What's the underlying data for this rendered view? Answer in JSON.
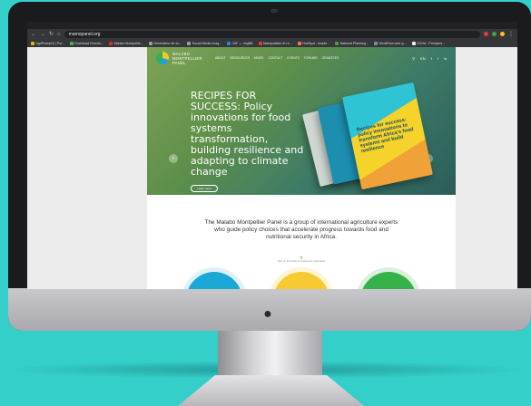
{
  "browser": {
    "url": "mamopanel.org",
    "bookmarks": [
      {
        "label": "AgriPolicyKit | Pol...",
        "color": "#f2b300"
      },
      {
        "label": "Download Exercis...",
        "color": "#4caf50"
      },
      {
        "label": "Malabo Montpellie...",
        "color": "#d32f2f"
      },
      {
        "label": "Générateur de su...",
        "color": "#9e9e9e"
      },
      {
        "label": "Social Media Imag...",
        "color": "#9e9e9e"
      },
      {
        "label": "JVF — ImgBB",
        "color": "#1e88e5"
      },
      {
        "label": "Manipulation et ré...",
        "color": "#e53935"
      },
      {
        "label": "HubSpot - Acade...",
        "color": "#ff7043"
      },
      {
        "label": "National Planning...",
        "color": "#43a047"
      },
      {
        "label": "WordFlow user g...",
        "color": "#78909c"
      },
      {
        "label": "OCHA - Principes...",
        "color": "#eeeeee"
      }
    ]
  },
  "site": {
    "logo_line1": "MALABO",
    "logo_line2": "MONTPELLIER",
    "logo_line3": "PANEL",
    "nav": [
      "ABOUT",
      "RESOURCES",
      "NEWS",
      "CONTACT",
      "EVENTS",
      "FORUMS",
      "GRANTEES"
    ],
    "lang": "EN",
    "social": [
      "f",
      "t",
      "in"
    ]
  },
  "hero": {
    "title": "RECIPES FOR SUCCESS: Policy innovations for food systems transformation, building resilience and adapting to climate change",
    "button": "Learn more",
    "book_title": "Recipes for success: policy innovations to transform Africa's food systems and build resilience",
    "prev": "‹",
    "next": "›"
  },
  "intro": {
    "text": "The Malabo Montpellier Panel is a group of international agriculture experts who guide policy choices that accelerate progress towards food and nutritional security in Africa.",
    "scroll_hint": "Click on the circles to reveal more information",
    "scroll_icon": "↯"
  },
  "colors": {
    "accent_blue": "#1aa8d6",
    "accent_yellow": "#f7c932",
    "accent_green": "#35b34a",
    "background": "#35cfca"
  }
}
